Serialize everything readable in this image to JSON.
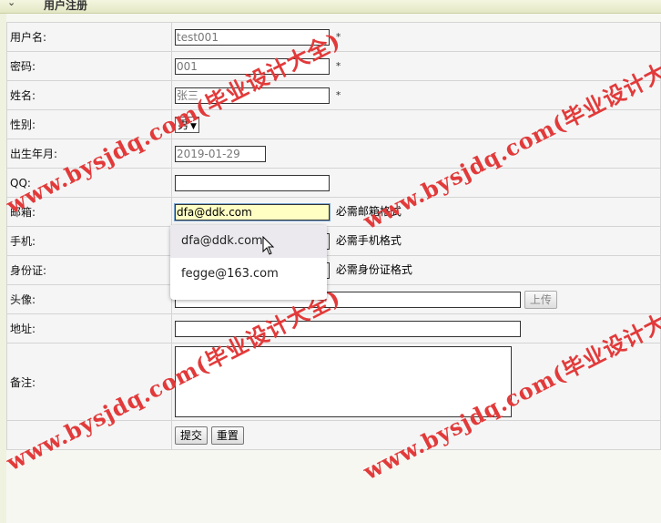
{
  "header": {
    "title": "用户注册",
    "collapse_icon": "caret-down-icon"
  },
  "form": {
    "username": {
      "label": "用户名:",
      "value": "test001",
      "required": "*"
    },
    "password": {
      "label": "密码:",
      "value": "001",
      "required": "*"
    },
    "realname": {
      "label": "姓名:",
      "value": "张三",
      "required": "*"
    },
    "gender": {
      "label": "性别:",
      "selected": "男"
    },
    "birthdate": {
      "label": "出生年月:",
      "value": "2019-01-29"
    },
    "qq": {
      "label": "QQ:",
      "value": ""
    },
    "email": {
      "label": "邮箱:",
      "value": "dfa@ddk.com",
      "hint": "必需邮箱格式"
    },
    "phone": {
      "label": "手机:",
      "value": "",
      "hint": "必需手机格式"
    },
    "idcard": {
      "label": "身份证:",
      "value": "",
      "hint": "必需身份证格式"
    },
    "avatar": {
      "label": "头像:",
      "value": "",
      "upload_label": "上传"
    },
    "address": {
      "label": "地址:",
      "value": ""
    },
    "remark": {
      "label": "备注:",
      "value": ""
    },
    "submit_label": "提交",
    "reset_label": "重置"
  },
  "autocomplete": {
    "items": [
      "dfa@ddk.com",
      "fegge@163.com"
    ],
    "hover_index": 0
  },
  "watermark": {
    "text": "www.bysjdq.com(毕业设计大全)",
    "color": "#e23a3a"
  }
}
